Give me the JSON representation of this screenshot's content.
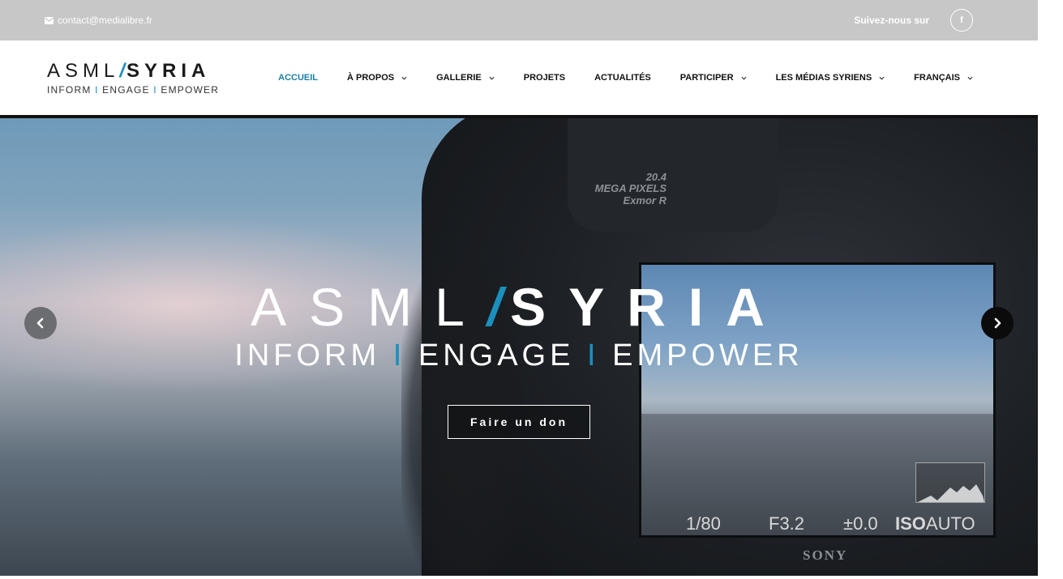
{
  "topbar": {
    "contact_email": "contact@medialibre.fr",
    "follow_label": "Suivez-nous sur",
    "facebook_icon": "f"
  },
  "logo": {
    "part1": "ASML",
    "slash": "/",
    "part2": "SYRIA",
    "tagline_1": "INFORM",
    "tagline_2": "ENGAGE",
    "tagline_3": "EMPOWER",
    "tagline_sep": "I"
  },
  "nav": {
    "items": [
      {
        "label": "ACCUEIL",
        "active": true,
        "dropdown": false
      },
      {
        "label": "À PROPOS",
        "active": false,
        "dropdown": true
      },
      {
        "label": "GALLERIE",
        "active": false,
        "dropdown": true
      },
      {
        "label": "PROJETS",
        "active": false,
        "dropdown": false
      },
      {
        "label": "ACTUALITÉS",
        "active": false,
        "dropdown": false
      },
      {
        "label": "PARTICIPER",
        "active": false,
        "dropdown": true
      },
      {
        "label": "LES MÉDIAS SYRIENS",
        "active": false,
        "dropdown": true
      },
      {
        "label": "FRANÇAIS",
        "active": false,
        "dropdown": true
      }
    ]
  },
  "hero": {
    "title_part1": "ASML",
    "title_slash": "/",
    "title_part2": "SYRIA",
    "sub_1": "INFORM",
    "sub_2": "ENGAGE",
    "sub_3": "EMPOWER",
    "sub_sep": "I",
    "donate_label": "Faire un don",
    "camera": {
      "megapixels": "20.4",
      "megapixels_label": "MEGA PIXELS",
      "sensor": "Exmor R",
      "shutter": "1/80",
      "aperture": "F3.2",
      "exposure": "±0.0",
      "iso_label": "ISO",
      "iso_value": "AUTO",
      "brand": "SONY"
    }
  },
  "colors": {
    "accent": "#1b8fbd",
    "nav_active": "#1b7fa6",
    "topbar_bg": "#c7c7c7"
  },
  "icons": {
    "mail": "envelope-icon",
    "facebook": "facebook-icon",
    "prev": "chevron-left-icon",
    "next": "chevron-right-icon",
    "dropdown": "chevron-down-icon"
  }
}
